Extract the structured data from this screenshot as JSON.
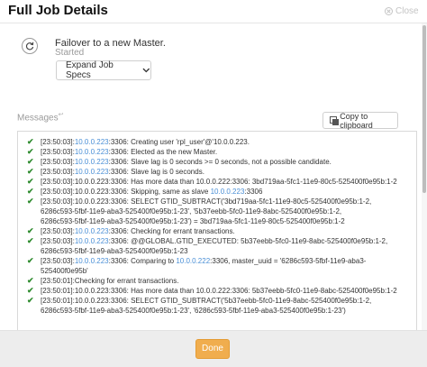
{
  "header": {
    "title": "Full Job Details",
    "close_label": "Close"
  },
  "job": {
    "title": "Failover to a new Master.",
    "status": "Started",
    "icon": "refresh-icon",
    "expand_label": "Expand Job Specs"
  },
  "messages": {
    "label": "Messages",
    "copy_label": "Copy to clipboard",
    "items": [
      {
        "ts": "[23:50:03]:",
        "parts": [
          {
            "t": "10.0.0.223",
            "h": true
          },
          {
            "t": ":3306: Creating user 'rpl_user'@'10.0.0.223."
          }
        ]
      },
      {
        "ts": "[23:50:03]:",
        "parts": [
          {
            "t": "10.0.0.223",
            "h": true
          },
          {
            "t": ":3306: Elected as the new Master."
          }
        ]
      },
      {
        "ts": "[23:50:03]:",
        "parts": [
          {
            "t": "10.0.0.223",
            "h": true
          },
          {
            "t": ":3306: Slave lag is 0 seconds >= 0 seconds, not a possible candidate."
          }
        ]
      },
      {
        "ts": "[23:50:03]:",
        "parts": [
          {
            "t": "10.0.0.223",
            "h": true
          },
          {
            "t": ":3306: Slave lag is 0 seconds."
          }
        ]
      },
      {
        "ts": "[23:50:03]:",
        "parts": [
          {
            "t": "10.0.0.223:3306: Has more data than 10.0.0.222:3306: 3bd719aa-5fc1-11e9-80c5-525400f0e95b:1-2"
          }
        ]
      },
      {
        "ts": "[23:50:03]:",
        "parts": [
          {
            "t": "10.0.0.223:3306: Skipping, same as slave "
          },
          {
            "t": "10.0.0.223",
            "h": true
          },
          {
            "t": ":3306"
          }
        ]
      },
      {
        "ts": "[23:50:03]:",
        "parts": [
          {
            "t": "10.0.0.223:3306: SELECT GTID_SUBTRACT('3bd719aa-5fc1-11e9-80c5-525400f0e95b:1-2,\n6286c593-5fbf-11e9-aba3-525400f0e95b:1-23', '5b37eebb-5fc0-11e9-8abc-525400f0e95b:1-2,\n6286c593-5fbf-11e9-aba3-525400f0e95b:1-23') = 3bd719aa-5fc1-11e9-80c5-525400f0e95b:1-2"
          }
        ]
      },
      {
        "ts": "[23:50:03]:",
        "parts": [
          {
            "t": "10.0.0.223",
            "h": true
          },
          {
            "t": ":3306: Checking for errant transactions."
          }
        ]
      },
      {
        "ts": "[23:50:03]:",
        "parts": [
          {
            "t": "10.0.0.223",
            "h": true
          },
          {
            "t": ":3306: @@GLOBAL.GTID_EXECUTED: 5b37eebb-5fc0-11e9-8abc-525400f0e95b:1-2,\n6286c593-5fbf-11e9-aba3-525400f0e95b:1-23"
          }
        ]
      },
      {
        "ts": "[23:50:03]:",
        "parts": [
          {
            "t": "10.0.0.223",
            "h": true
          },
          {
            "t": ":3306: Comparing to "
          },
          {
            "t": "10.0.0.222",
            "h": true
          },
          {
            "t": ":3306, master_uuid = '6286c593-5fbf-11e9-aba3-\n525400f0e95b'"
          }
        ]
      },
      {
        "ts": "[23:50:01]:",
        "parts": [
          {
            "t": "Checking for errant transactions."
          }
        ]
      },
      {
        "ts": "[23:50:01]:",
        "parts": [
          {
            "t": "10.0.0.223:3306: Has more data than 10.0.0.222:3306: 5b37eebb-5fc0-11e9-8abc-525400f0e95b:1-2"
          }
        ]
      },
      {
        "ts": "[23:50:01]:",
        "parts": [
          {
            "t": "10.0.0.223:3306: SELECT GTID_SUBTRACT('5b37eebb-5fc0-11e9-8abc-525400f0e95b:1-2,\n6286c593-5fbf-11e9-aba3-525400f0e95b:1-23', '6286c593-5fbf-11e9-aba3-525400f0e95b:1-23')"
          }
        ]
      }
    ]
  },
  "footer": {
    "done_label": "Done"
  },
  "colors": {
    "accent": "#f0ad4e",
    "success": "#2e8b2e",
    "link": "#4a8fd6"
  }
}
